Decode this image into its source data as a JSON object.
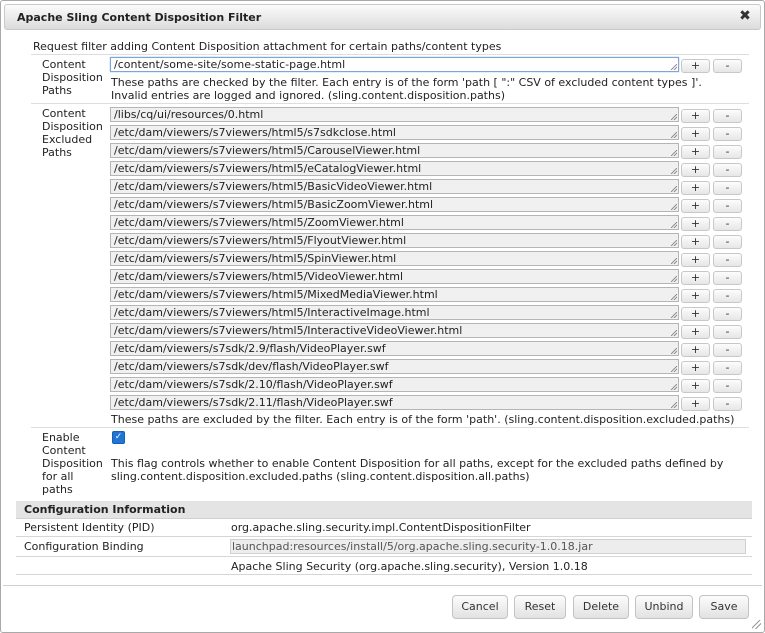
{
  "dialog": {
    "title": "Apache Sling Content Disposition Filter",
    "close_symbol": "✖",
    "description": "Request filter adding Content Disposition attachment for certain paths/content types"
  },
  "paths": {
    "label": "Content Disposition Paths",
    "value": "/content/some-site/some-static-page.html",
    "help": "These paths are checked by the filter. Each entry is of the form 'path [ \":\" CSV of excluded content types ]'. Invalid entries are logged and ignored. (sling.content.disposition.paths)"
  },
  "excluded": {
    "label": "Content Disposition Excluded Paths",
    "values": [
      "/libs/cq/ui/resources/0.html",
      "/etc/dam/viewers/s7viewers/html5/s7sdkclose.html",
      "/etc/dam/viewers/s7viewers/html5/CarouselViewer.html",
      "/etc/dam/viewers/s7viewers/html5/eCatalogViewer.html",
      "/etc/dam/viewers/s7viewers/html5/BasicVideoViewer.html",
      "/etc/dam/viewers/s7viewers/html5/BasicZoomViewer.html",
      "/etc/dam/viewers/s7viewers/html5/ZoomViewer.html",
      "/etc/dam/viewers/s7viewers/html5/FlyoutViewer.html",
      "/etc/dam/viewers/s7viewers/html5/SpinViewer.html",
      "/etc/dam/viewers/s7viewers/html5/VideoViewer.html",
      "/etc/dam/viewers/s7viewers/html5/MixedMediaViewer.html",
      "/etc/dam/viewers/s7viewers/html5/InteractiveImage.html",
      "/etc/dam/viewers/s7viewers/html5/InteractiveVideoViewer.html",
      "/etc/dam/viewers/s7sdk/2.9/flash/VideoPlayer.swf",
      "/etc/dam/viewers/s7sdk/dev/flash/VideoPlayer.swf",
      "/etc/dam/viewers/s7sdk/2.10/flash/VideoPlayer.swf",
      "/etc/dam/viewers/s7sdk/2.11/flash/VideoPlayer.swf"
    ],
    "help": "These paths are excluded by the filter. Each entry is of the form 'path'. (sling.content.disposition.excluded.paths)"
  },
  "enable": {
    "label": "Enable Content Disposition for all paths",
    "checked": true,
    "check_symbol": "✓",
    "help": "This flag controls whether to enable Content Disposition for all paths, except for the excluded paths defined by sling.content.disposition.excluded.paths (sling.content.disposition.all.paths)"
  },
  "row_buttons": {
    "add": "+",
    "remove": "-"
  },
  "config_info": {
    "heading": "Configuration Information",
    "pid_label": "Persistent Identity (PID)",
    "pid_value": "org.apache.sling.security.impl.ContentDispositionFilter",
    "binding_label": "Configuration Binding",
    "binding_value": "launchpad:resources/install/5/org.apache.sling.security-1.0.18.jar",
    "bundle_value": "Apache Sling Security (org.apache.sling.security), Version 1.0.18"
  },
  "footer": {
    "cancel": "Cancel",
    "reset": "Reset",
    "delete": "Delete",
    "unbind": "Unbind",
    "save": "Save"
  },
  "colors": {
    "checkbox": "#1f74d6",
    "focus_border": "#7aa7d8"
  }
}
